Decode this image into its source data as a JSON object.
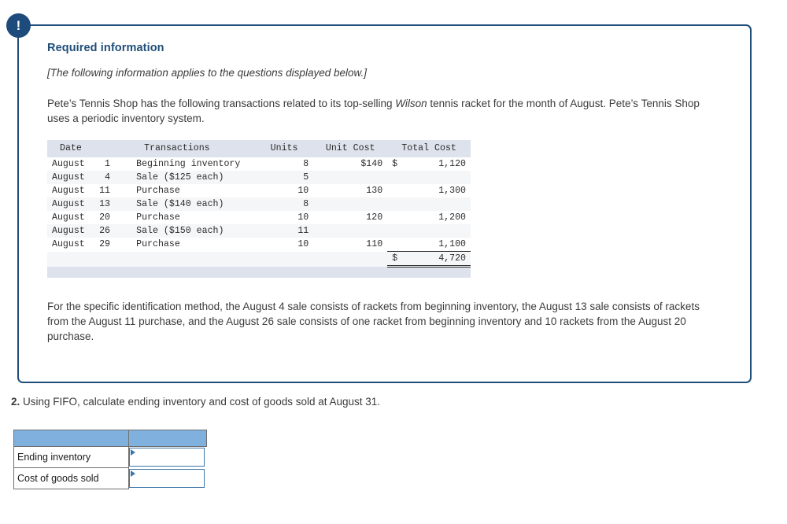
{
  "card": {
    "badge_glyph": "!",
    "heading": "Required information",
    "italic_note": "[The following information applies to the questions displayed below.]",
    "intro": {
      "before_brand": "Pete’s Tennis Shop has the following transactions related to its top-selling ",
      "brand": "Wilson",
      "after_brand": " tennis racket for the month of August. Pete’s Tennis Shop uses a periodic inventory system."
    },
    "spec_id_paragraph": "For the specific identification method, the August 4 sale consists of rackets from beginning inventory, the August 13 sale consists of rackets from the August 11 purchase, and the August 26 sale consists of one racket from beginning inventory and 10 rackets from the August 20 purchase."
  },
  "txn_table": {
    "headers": [
      "Date",
      "Transactions",
      "Units",
      "Unit Cost",
      "Total Cost"
    ],
    "rows": [
      {
        "month": "August",
        "day": "1",
        "transaction": "Beginning inventory",
        "units": "8",
        "unit_cost": "$140",
        "currency": "$",
        "total_cost": "1,120"
      },
      {
        "month": "August",
        "day": "4",
        "transaction": "Sale ($125 each)",
        "units": "5",
        "unit_cost": "",
        "currency": "",
        "total_cost": ""
      },
      {
        "month": "August",
        "day": "11",
        "transaction": "Purchase",
        "units": "10",
        "unit_cost": "130",
        "currency": "",
        "total_cost": "1,300"
      },
      {
        "month": "August",
        "day": "13",
        "transaction": "Sale ($140 each)",
        "units": "8",
        "unit_cost": "",
        "currency": "",
        "total_cost": ""
      },
      {
        "month": "August",
        "day": "20",
        "transaction": "Purchase",
        "units": "10",
        "unit_cost": "120",
        "currency": "",
        "total_cost": "1,200"
      },
      {
        "month": "August",
        "day": "26",
        "transaction": "Sale ($150 each)",
        "units": "11",
        "unit_cost": "",
        "currency": "",
        "total_cost": ""
      },
      {
        "month": "August",
        "day": "29",
        "transaction": "Purchase",
        "units": "10",
        "unit_cost": "110",
        "currency": "",
        "total_cost": "1,100"
      }
    ],
    "total": {
      "currency": "$",
      "value": "4,720"
    }
  },
  "question": {
    "number": "2.",
    "text": " Using FIFO, calculate ending inventory and cost of goods sold at August 31."
  },
  "answer_table": {
    "header_left": "",
    "header_right": "",
    "rows": [
      {
        "label": "Ending inventory",
        "value": ""
      },
      {
        "label": "Cost of goods sold",
        "value": ""
      }
    ]
  },
  "colors": {
    "card_border": "#1f4e79",
    "badge": "#1d4b7c",
    "heading": "#1f4e79",
    "table_header_bg": "#dde2ec",
    "table_alt_row_bg": "#f5f6f8",
    "answer_header_bg": "#7fb0de",
    "input_border": "#3c77ab"
  }
}
